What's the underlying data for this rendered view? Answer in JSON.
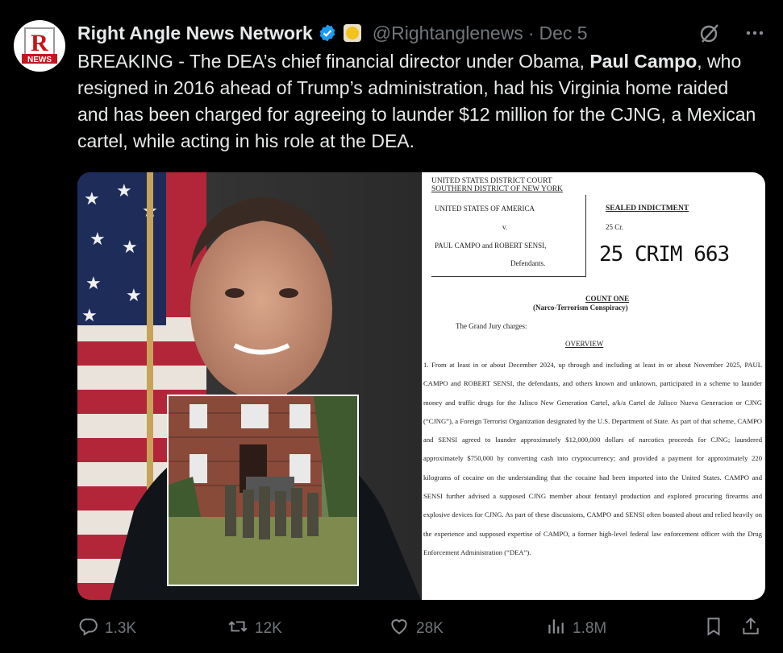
{
  "author": {
    "display_name": "Right Angle News Network",
    "handle": "@Rightanglenews",
    "separator": "·",
    "date": "Dec 5",
    "avatar_text": "R",
    "avatar_subtext": "NEWS"
  },
  "tweet": {
    "text_before": "BREAKING - The DEA’s chief financial director under Obama, ",
    "text_bold": "Paul Campo",
    "text_after": ", who resigned in 2016 ahead of Trump’s administration, had his Virginia home raided and has been charged for agreeing to launder $12 million for the CJNG, a Mexican cartel, while acting in his role at the DEA."
  },
  "document": {
    "court_line1": "UNITED STATES DISTRICT COURT",
    "court_line2": "SOUTHERN DISTRICT OF NEW YORK",
    "plaintiff": "UNITED STATES OF AMERICA",
    "versus": "v.",
    "defendant_names": "PAUL CAMPO and ROBERT SENSI,",
    "defendants_label": "Defendants.",
    "sealed": "SEALED INDICTMENT",
    "cr_number": "25 Cr.",
    "crim_stamp": "25 CRIM 663",
    "count_one": "COUNT ONE",
    "count_subtitle": "(Narco-Terrorism Conspiracy)",
    "grand_jury": "The Grand Jury charges:",
    "overview": "OVERVIEW",
    "paragraph": "1.      From at least in or about December 2024, up through and including at least in or about November 2025, PAUL CAMPO and ROBERT SENSI, the defendants, and others known and unknown, participated in a scheme to launder money and traffic drugs for the Jalisco New Generation Cartel, a/k/a Cartel de Jalisco Nueva Generacion or CJNG (“CJNG”), a Foreign Terrorist Organization designated by the U.S. Department of State. As part of that scheme, CAMPO and SENSI agreed to launder approximately $12,000,000 dollars of narcotics proceeds for CJNG; laundered approximately $750,000 by converting cash into cryptocurrency; and provided a payment for approximately 220 kilograms of cocaine on the understanding that the cocaine had been imported into the United States. CAMPO and SENSI further advised a supposed CJNG member about fentanyl production and explored procuring firearms and explosive devices for CJNG. As part of these discussions, CAMPO and SENSI often boasted about and relied heavily on the experience and supposed expertise of CAMPO, a former high-level federal law enforcement officer with the Drug Enforcement Administration (“DEA”)."
  },
  "actions": {
    "replies": "1.3K",
    "reposts": "12K",
    "likes": "28K",
    "views": "1.8M"
  },
  "icons": [
    "verified-badge-icon",
    "gold-affiliate-badge-icon",
    "grok-icon",
    "more-icon",
    "reply-icon",
    "repost-icon",
    "like-icon",
    "views-icon",
    "bookmark-icon",
    "share-icon"
  ],
  "colors": {
    "background": "#000000",
    "text": "#e7e9ea",
    "muted": "#71767b",
    "verified": "#1d9bf0"
  }
}
